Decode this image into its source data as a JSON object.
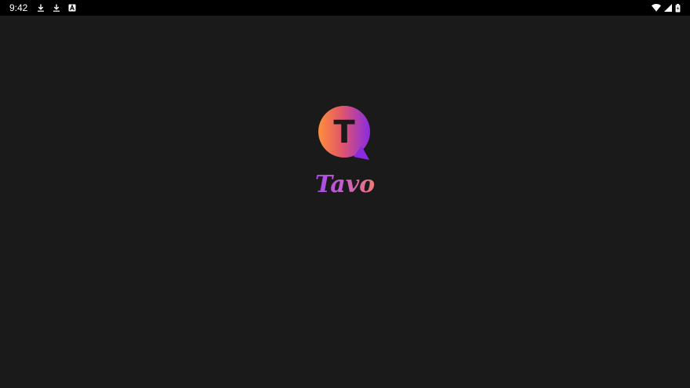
{
  "status_bar": {
    "time": "9:42",
    "notification_icons": [
      "download-icon",
      "download-icon",
      "font-icon"
    ],
    "system_icons": [
      "wifi-icon",
      "cellular-signal-icon",
      "battery-charging-icon"
    ]
  },
  "splash": {
    "logo_letter": "T",
    "app_name": "Tavo"
  },
  "colors": {
    "background": "#1a1a1a",
    "status_bar": "#000000",
    "brand_orange": "#ff8a4c",
    "brand_purple": "#8a2be2"
  }
}
